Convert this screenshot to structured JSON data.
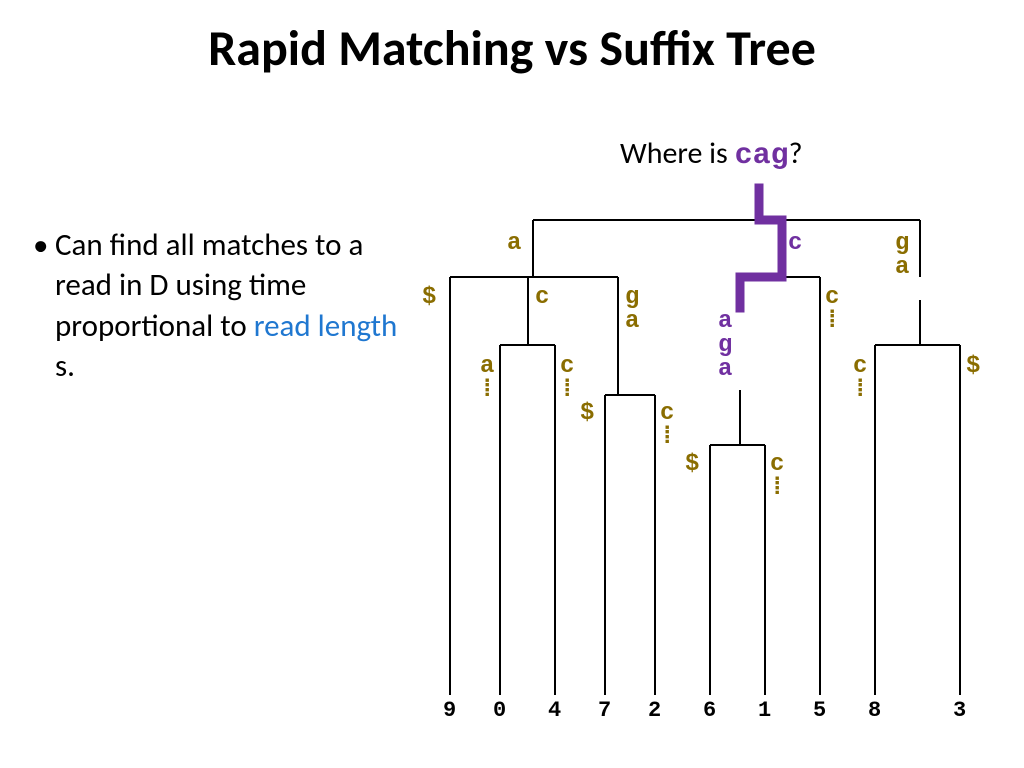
{
  "title": "Rapid Matching vs Suffix Tree",
  "bullet": {
    "text_before": "Can find all matches to a read in D using time proportional to ",
    "highlight": "read length",
    "text_after": " s."
  },
  "query": {
    "prefix": "Where is ",
    "pattern": "cag",
    "suffix": "?"
  },
  "tree": {
    "top_labels": {
      "a": "a",
      "c": "c",
      "ga": "g\na"
    },
    "a_children": {
      "dollar": "$",
      "c": "c",
      "ga": "g\na"
    },
    "a_c_children": {
      "a": "a\n⁞",
      "c": "c\n⁞"
    },
    "a_ga_children": {
      "dollar": "$",
      "c": "c\n⁞"
    },
    "c_children": {
      "aga": "a\ng\na",
      "c": "c\n⁞"
    },
    "c_aga_children": {
      "dollar": "$",
      "c": "c\n⁞"
    },
    "ga_children": {
      "c": "c\n⁞",
      "dollar": "$"
    },
    "leaves": [
      "9",
      "0",
      "4",
      "7",
      "2",
      "6",
      "1",
      "5",
      "8",
      "3"
    ]
  }
}
